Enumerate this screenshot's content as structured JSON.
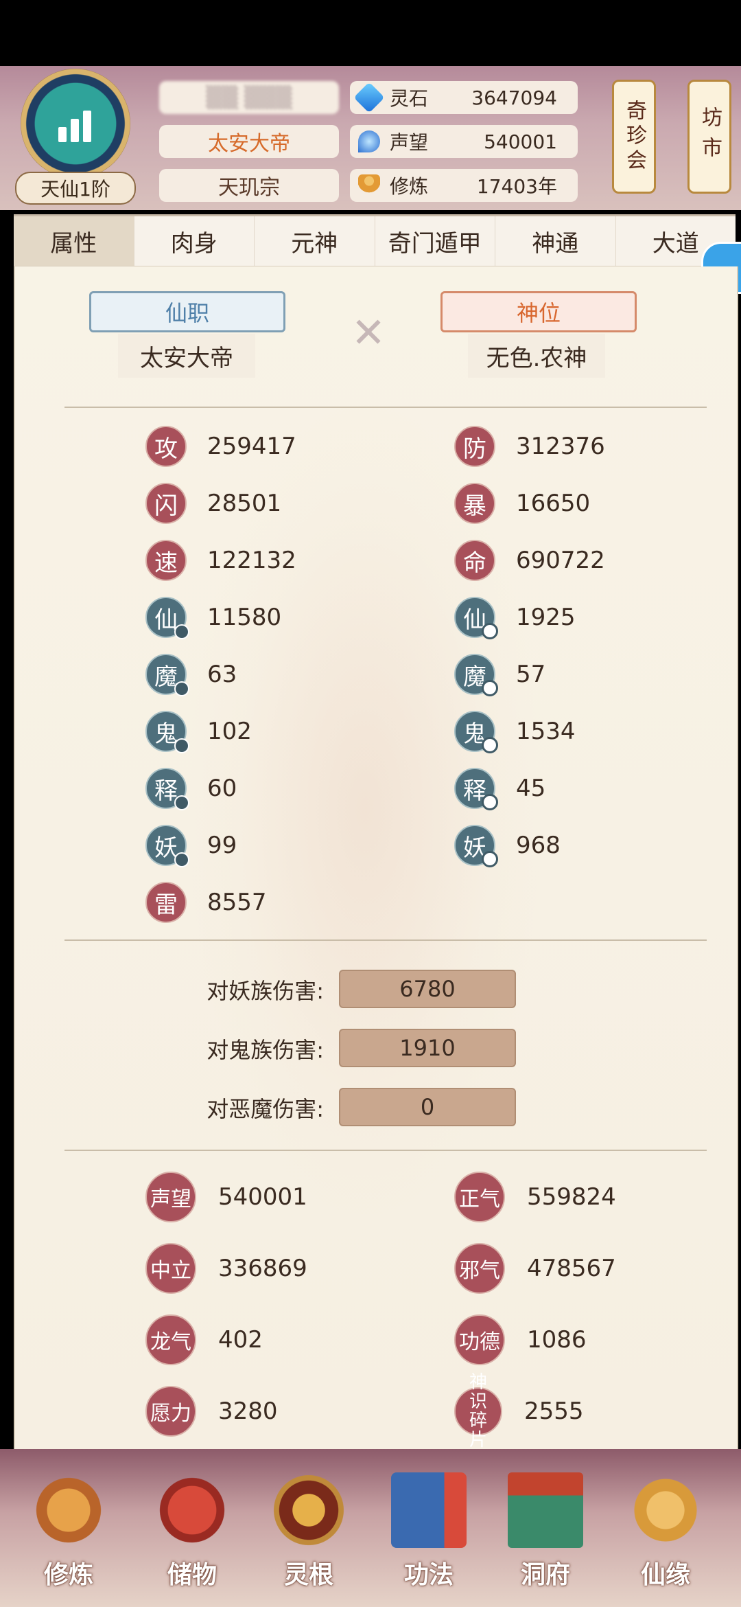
{
  "header": {
    "rank": "天仙1阶",
    "title_pill": "太安大帝",
    "sect_pill": "天玑宗",
    "resources": [
      {
        "label": "灵石",
        "value": "3647094",
        "icon": "spirit-stone-icon"
      },
      {
        "label": "声望",
        "value": "540001",
        "icon": "reputation-icon"
      },
      {
        "label": "修炼",
        "value": "17403年",
        "icon": "meditation-icon"
      }
    ],
    "side_buttons": [
      {
        "label": "奇珍会"
      },
      {
        "label": "坊市"
      }
    ]
  },
  "tabs": [
    {
      "label": "属性",
      "active": true
    },
    {
      "label": "肉身"
    },
    {
      "label": "元神"
    },
    {
      "label": "奇门遁甲"
    },
    {
      "label": "神通"
    },
    {
      "label": "大道"
    }
  ],
  "titles": {
    "left": {
      "banner": "仙职",
      "value": "太安大帝"
    },
    "right": {
      "banner": "神位",
      "value": "无色.农神"
    }
  },
  "stats_left": [
    {
      "glyph": "攻",
      "value": "259417"
    },
    {
      "glyph": "闪",
      "value": "28501"
    },
    {
      "glyph": "速",
      "value": "122132"
    },
    {
      "glyph": "仙",
      "value": "11580"
    },
    {
      "glyph": "魔",
      "value": "63"
    },
    {
      "glyph": "鬼",
      "value": "102"
    },
    {
      "glyph": "释",
      "value": "60"
    },
    {
      "glyph": "妖",
      "value": "99"
    },
    {
      "glyph": "雷",
      "value": "8557"
    }
  ],
  "stats_right": [
    {
      "glyph": "防",
      "value": "312376"
    },
    {
      "glyph": "暴",
      "value": "16650"
    },
    {
      "glyph": "命",
      "value": "690722"
    },
    {
      "glyph": "仙",
      "value": "1925"
    },
    {
      "glyph": "魔",
      "value": "57"
    },
    {
      "glyph": "鬼",
      "value": "1534"
    },
    {
      "glyph": "释",
      "value": "45"
    },
    {
      "glyph": "妖",
      "value": "968"
    }
  ],
  "damage": [
    {
      "label": "对妖族伤害:",
      "value": "6780"
    },
    {
      "label": "对鬼族伤害:",
      "value": "1910"
    },
    {
      "label": "对恶魔伤害:",
      "value": "0"
    }
  ],
  "reputation": [
    {
      "label": "声望",
      "value": "540001"
    },
    {
      "label": "正气",
      "value": "559824"
    },
    {
      "label": "中立",
      "value": "336869"
    },
    {
      "label": "邪气",
      "value": "478567"
    },
    {
      "label": "龙气",
      "value": "402"
    },
    {
      "label": "功德",
      "value": "1086"
    },
    {
      "label": "愿力",
      "value": "3280"
    },
    {
      "label": "神识碎片",
      "value": "2555"
    }
  ],
  "bottom_nav": [
    {
      "label": "修炼"
    },
    {
      "label": "储物"
    },
    {
      "label": "灵根"
    },
    {
      "label": "功法"
    },
    {
      "label": "洞府"
    },
    {
      "label": "仙缘"
    }
  ]
}
